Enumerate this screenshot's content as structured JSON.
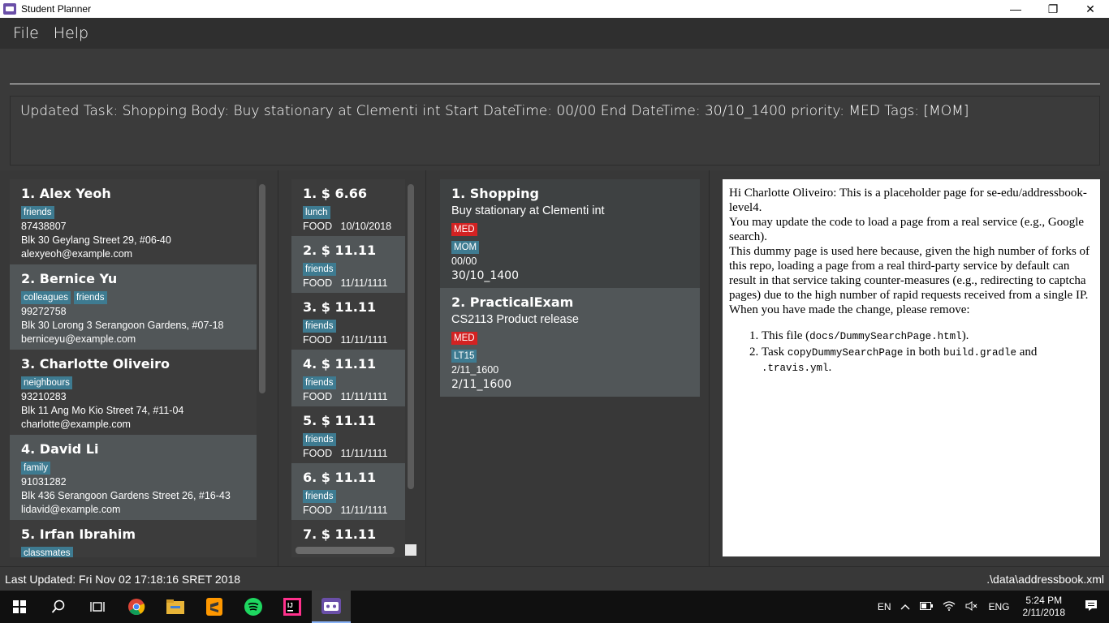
{
  "window": {
    "title": "Student Planner",
    "minimize": "—",
    "restore": "❐",
    "close": "✕"
  },
  "menu": {
    "file": "File",
    "help": "Help"
  },
  "command": {
    "value": "",
    "placeholder": ""
  },
  "result": {
    "text": "Updated Task: Shopping Body: Buy stationary at Clementi int Start DateTime: 00/00 End DateTime: 30/10_1400 priority: MED Tags: [MOM]"
  },
  "persons": [
    {
      "title": "1.  Alex Yeoh",
      "tags": [
        "friends"
      ],
      "phone": "87438807",
      "address": "Blk 30 Geylang Street 29, #06-40",
      "email": "alexyeoh@example.com"
    },
    {
      "title": "2.  Bernice Yu",
      "tags": [
        "colleagues",
        "friends"
      ],
      "phone": "99272758",
      "address": "Blk 30 Lorong 3 Serangoon Gardens, #07-18",
      "email": "berniceyu@example.com"
    },
    {
      "title": "3.  Charlotte Oliveiro",
      "tags": [
        "neighbours"
      ],
      "phone": "93210283",
      "address": "Blk 11 Ang Mo Kio Street 74, #11-04",
      "email": "charlotte@example.com"
    },
    {
      "title": "4.  David Li",
      "tags": [
        "family"
      ],
      "phone": "91031282",
      "address": "Blk 436 Serangoon Gardens Street 26, #16-43",
      "email": "lidavid@example.com"
    },
    {
      "title": "5.  Irfan Ibrahim",
      "tags": [
        "classmates"
      ],
      "phone": "",
      "address": "",
      "email": ""
    }
  ],
  "expenses": [
    {
      "title": "1.  $ 6.66",
      "tag": "lunch",
      "category": "FOOD",
      "date": "10/10/2018"
    },
    {
      "title": "2.  $ 11.11",
      "tag": "friends",
      "category": "FOOD",
      "date": "11/11/1111"
    },
    {
      "title": "3.  $ 11.11",
      "tag": "friends",
      "category": "FOOD",
      "date": "11/11/1111"
    },
    {
      "title": "4.  $ 11.11",
      "tag": "friends",
      "category": "FOOD",
      "date": "11/11/1111"
    },
    {
      "title": "5.  $ 11.11",
      "tag": "friends",
      "category": "FOOD",
      "date": "11/11/1111"
    },
    {
      "title": "6.  $ 11.11",
      "tag": "friends",
      "category": "FOOD",
      "date": "11/11/1111"
    },
    {
      "title": "7.  $ 11.11",
      "tag": "",
      "category": "",
      "date": ""
    }
  ],
  "tasks": [
    {
      "title": "1.  Shopping",
      "body": "Buy stationary at Clementi int",
      "priority": "MED",
      "tag": "MOM",
      "start": "00/00",
      "end": "30/10_1400"
    },
    {
      "title": "2.  PracticalExam",
      "body": "CS2113 Product release",
      "priority": "MED",
      "tag": "LT15",
      "start": "2/11_1600",
      "end": "2/11_1600"
    }
  ],
  "browser": {
    "p1": "Hi Charlotte Oliveiro: This is a placeholder page for se-edu/addressbook-level4.",
    "p2": "You may update the code to load a page from a real service (e.g., Google search).",
    "p3": "This dummy page is used here because, given the high number of forks of this repo, loading a page from a real third-party service by default can result in that service taking counter-measures (e.g., redirecting to captcha pages) due to the high number of rapid requests received from a single IP.",
    "p4": "When you have made the change, please remove:",
    "li1_a": "This file (",
    "li1_code": "docs/DummySearchPage.html",
    "li1_b": ").",
    "li2_a": "Task ",
    "li2_code1": "copyDummySearchPage",
    "li2_b": " in both ",
    "li2_code2": "build.gradle",
    "li2_c": " and ",
    "li2_code3": ".travis.yml",
    "li2_d": "."
  },
  "status": {
    "updated": "Last Updated: Fri Nov 02 17:18:16 SRET 2018",
    "path": ".\\data\\addressbook.xml"
  },
  "taskbar": {
    "lang1": "EN",
    "lang2": "ENG",
    "time": "5:24 PM",
    "date": "2/11/2018"
  },
  "colors": {
    "tag": "#3e7b91",
    "priority": "#d32222",
    "card_light": "#515658",
    "card_dark": "#3c3c3c"
  }
}
